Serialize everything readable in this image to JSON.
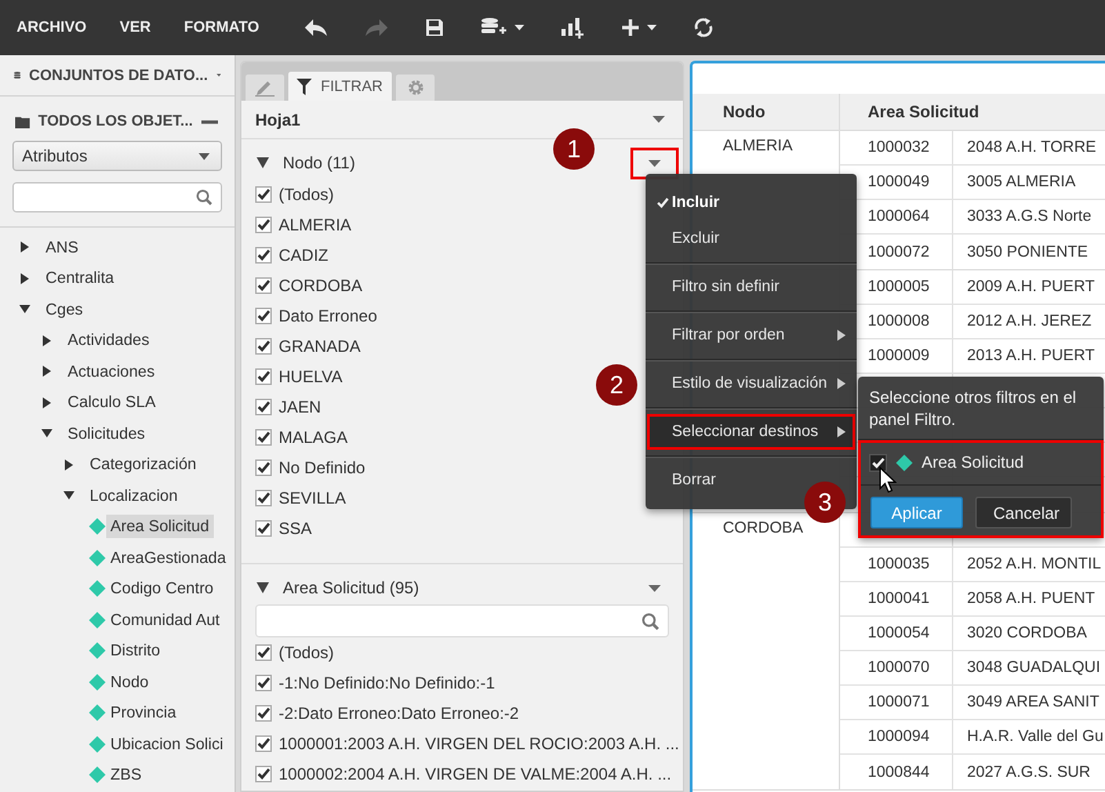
{
  "toolbar": {
    "menus": [
      "ARCHIVO",
      "VER",
      "FORMATO"
    ],
    "tools": [
      {
        "kind": "undo",
        "disabled": false
      },
      {
        "kind": "redo",
        "disabled": true
      },
      {
        "kind": "save",
        "disabled": false
      },
      {
        "kind": "add-data",
        "disabled": false,
        "caret": true
      },
      {
        "kind": "add-chart",
        "disabled": false,
        "caret": false
      },
      {
        "kind": "add",
        "disabled": false,
        "caret": true
      },
      {
        "kind": "refresh",
        "disabled": false,
        "caret": false
      }
    ]
  },
  "sidebar": {
    "datasets_title": "CONJUNTOS DE DATO...",
    "objects_title": "TODOS LOS OBJET...",
    "view_select": {
      "value": "Atributos"
    },
    "tree": [
      {
        "label": "ANS",
        "kind": "folder",
        "expanded": false,
        "selected": false
      },
      {
        "label": "Centralita",
        "kind": "folder",
        "expanded": false,
        "selected": false
      },
      {
        "label": "Cges",
        "kind": "folder",
        "expanded": true,
        "selected": false,
        "children": [
          {
            "label": "Actividades",
            "kind": "folder",
            "expanded": false,
            "selected": false
          },
          {
            "label": "Actuaciones",
            "kind": "folder",
            "expanded": false,
            "selected": false
          },
          {
            "label": "Calculo SLA",
            "kind": "folder",
            "expanded": false,
            "selected": false
          },
          {
            "label": "Solicitudes",
            "kind": "folder",
            "expanded": true,
            "selected": false,
            "children": [
              {
                "label": "Categorización",
                "kind": "folder",
                "expanded": false,
                "selected": false
              },
              {
                "label": "Localizacion",
                "kind": "folder",
                "expanded": true,
                "selected": false,
                "children": [
                  {
                    "label": "Area Solicitud",
                    "kind": "attribute",
                    "selected": true
                  },
                  {
                    "label": "AreaGestionada",
                    "kind": "attribute",
                    "selected": false
                  },
                  {
                    "label": "Codigo Centro",
                    "kind": "attribute",
                    "selected": false
                  },
                  {
                    "label": "Comunidad Aut",
                    "kind": "attribute",
                    "selected": false
                  },
                  {
                    "label": "Distrito",
                    "kind": "attribute",
                    "selected": false
                  },
                  {
                    "label": "Nodo",
                    "kind": "attribute",
                    "selected": false
                  },
                  {
                    "label": "Provincia",
                    "kind": "attribute",
                    "selected": false
                  },
                  {
                    "label": "Ubicacion Solici",
                    "kind": "attribute",
                    "selected": false
                  },
                  {
                    "label": "ZBS",
                    "kind": "attribute",
                    "selected": false
                  }
                ]
              }
            ]
          }
        ]
      }
    ]
  },
  "filter_panel": {
    "tabs": [
      {
        "kind": "edit",
        "selected": false
      },
      {
        "kind": "filter",
        "label": "FILTRAR",
        "selected": true
      },
      {
        "kind": "settings",
        "selected": false
      }
    ],
    "sheet": "Hoja1",
    "filters": [
      {
        "title": "Nodo (11)",
        "expanded": true,
        "has_search": false,
        "caret_outlined": true,
        "items": [
          {
            "label": "(Todos)",
            "checked": true
          },
          {
            "label": "ALMERIA",
            "checked": true
          },
          {
            "label": "CADIZ",
            "checked": true
          },
          {
            "label": "CORDOBA",
            "checked": true
          },
          {
            "label": "Dato Erroneo",
            "checked": true
          },
          {
            "label": "GRANADA",
            "checked": true
          },
          {
            "label": "HUELVA",
            "checked": true
          },
          {
            "label": "JAEN",
            "checked": true
          },
          {
            "label": "MALAGA",
            "checked": true
          },
          {
            "label": "No Definido",
            "checked": true
          },
          {
            "label": "SEVILLA",
            "checked": true
          },
          {
            "label": "SSA",
            "checked": true
          }
        ]
      },
      {
        "title": "Area Solicitud (95)",
        "expanded": true,
        "has_search": true,
        "caret_outlined": false,
        "items": [
          {
            "label": "(Todos)",
            "checked": true
          },
          {
            "label": "-1:No Definido:No Definido:-1",
            "checked": true
          },
          {
            "label": "-2:Dato Erroneo:Dato Erroneo:-2",
            "checked": true
          },
          {
            "label": "1000001:2003 A.H. VIRGEN DEL ROCIO:2003 A.H. ...",
            "checked": true
          },
          {
            "label": "1000002:2004 A.H. VIRGEN DE VALME:2004 A.H. ...",
            "checked": true
          }
        ]
      }
    ]
  },
  "grid": {
    "columns": [
      "Nodo",
      "Area Solicitud"
    ],
    "groups": [
      {
        "node": "ALMERIA",
        "rows": [
          {
            "code": "1000032",
            "name": "2048 A.H. TORRE"
          },
          {
            "code": "1000049",
            "name": "3005 ALMERIA"
          },
          {
            "code": "1000064",
            "name": "3033 A.G.S Norte"
          },
          {
            "code": "1000072",
            "name": "3050 PONIENTE"
          }
        ]
      },
      {
        "rows": [
          {
            "code": "1000005",
            "name": "2009 A.H. PUERT"
          },
          {
            "code": "1000008",
            "name": "2012 A.H. JEREZ"
          },
          {
            "code": "1000009",
            "name": "2013 A.H. PUERT"
          },
          {},
          {},
          {},
          {}
        ]
      },
      {
        "node": "CORDOBA",
        "rows": [
          {},
          {
            "code": "1000035",
            "name": "2052 A.H. MONTIL"
          },
          {
            "code": "1000041",
            "name": "2058 A.H. PUENT"
          },
          {
            "code": "1000054",
            "name": "3020 CORDOBA"
          },
          {
            "code": "1000070",
            "name": "3048 GUADALQUI"
          },
          {
            "code": "1000071",
            "name": "3049 AREA SANIT"
          },
          {
            "code": "1000094",
            "name": "H.A.R. Valle del Gu"
          },
          {
            "code": "1000844",
            "name": "2027 A.G.S. SUR"
          }
        ]
      }
    ]
  },
  "context_menu": {
    "sections": [
      {
        "items": [
          {
            "label": "Incluir",
            "checked": true,
            "submenu": false,
            "hovered": false,
            "outlined": false
          },
          {
            "label": "Excluir",
            "checked": false,
            "submenu": false,
            "hovered": false,
            "outlined": false
          }
        ]
      },
      {
        "items": [
          {
            "label": "Filtro sin definir",
            "checked": false,
            "submenu": false,
            "hovered": false,
            "outlined": false
          }
        ]
      },
      {
        "items": [
          {
            "label": "Filtrar por orden",
            "checked": false,
            "submenu": true,
            "hovered": false,
            "outlined": false
          }
        ]
      },
      {
        "items": [
          {
            "label": "Estilo de visualización",
            "checked": false,
            "submenu": true,
            "hovered": false,
            "outlined": false
          }
        ]
      },
      {
        "items": [
          {
            "label": "Seleccionar destinos",
            "checked": false,
            "submenu": true,
            "hovered": true,
            "outlined": true
          }
        ]
      },
      {
        "items": [
          {
            "label": "Borrar",
            "checked": false,
            "submenu": false,
            "hovered": false,
            "outlined": false
          }
        ]
      }
    ]
  },
  "submenu": {
    "hint": "Seleccione otros filtros en el panel Filtro.",
    "outlined": true,
    "targets": [
      {
        "label": "Area Solicitud",
        "checked": true
      }
    ],
    "buttons": [
      {
        "label": "Aplicar",
        "kind": "primary"
      },
      {
        "label": "Cancelar",
        "kind": "secondary"
      }
    ]
  },
  "annotations": [
    {
      "label": "1"
    },
    {
      "label": "2"
    },
    {
      "label": "3"
    }
  ]
}
